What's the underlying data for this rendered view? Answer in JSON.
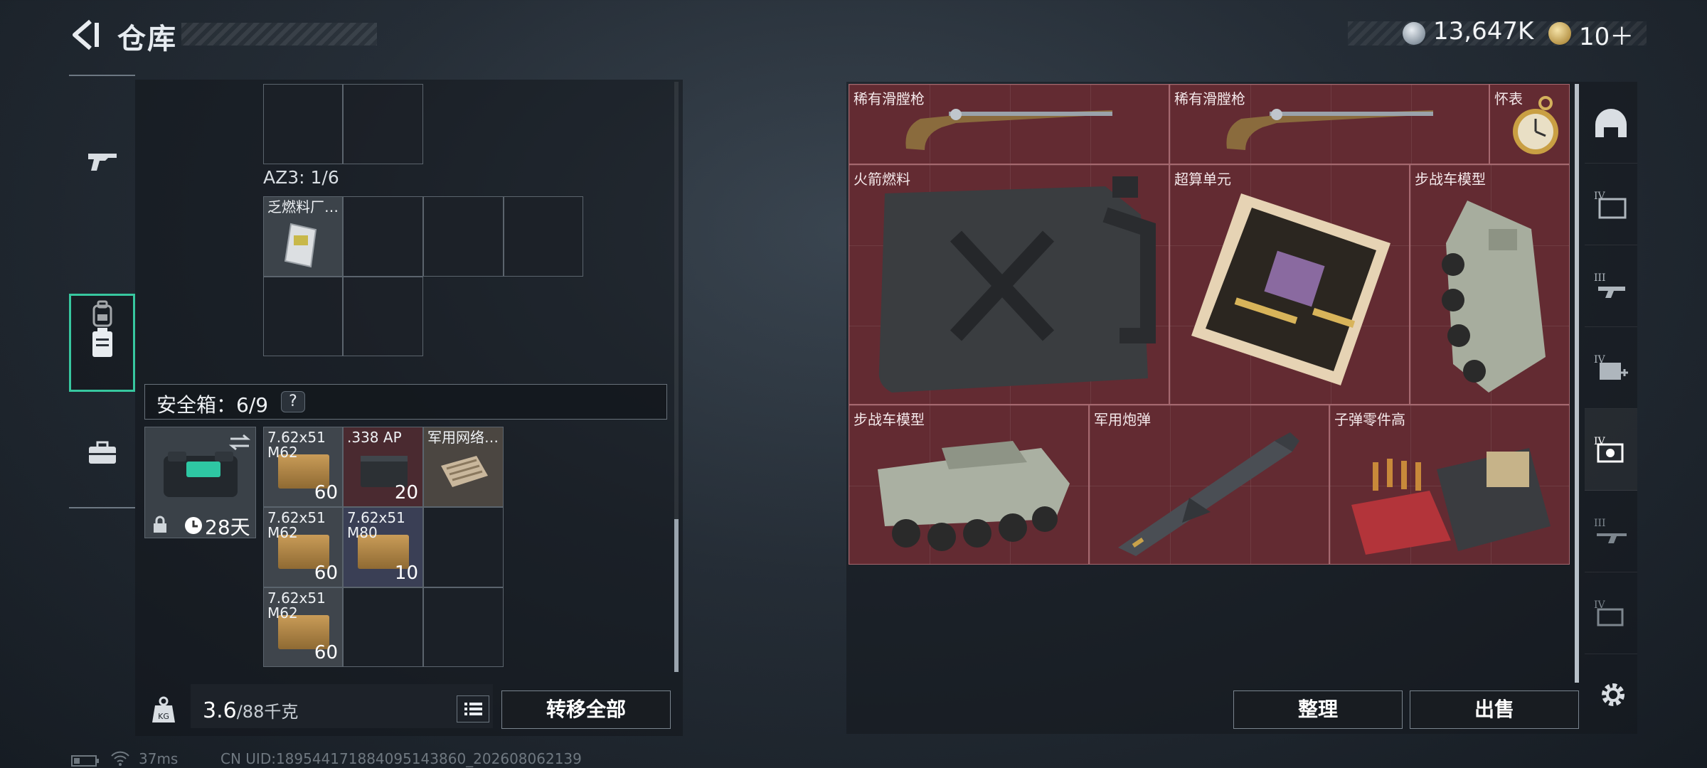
{
  "header": {
    "title": "仓库",
    "currencies": [
      {
        "icon": "silver-coin-icon",
        "value": "13,647K"
      },
      {
        "icon": "gold-coin-icon",
        "value": "10＋"
      }
    ]
  },
  "left_nav": {
    "items": [
      {
        "name": "weapons",
        "icon": "rifle-icon"
      },
      {
        "name": "armor",
        "icon": "backpack-icon"
      },
      {
        "name": "containers",
        "icon": "container-icon",
        "active": true
      },
      {
        "name": "case",
        "icon": "briefcase-icon"
      }
    ]
  },
  "inventory": {
    "az3_label": "AZ3: 1/6",
    "fuel_item_name": "乏燃料厂…",
    "safe_box": {
      "label": "安全箱：6/9",
      "help": "?"
    },
    "secure_case": {
      "time": "28天"
    },
    "ammo": [
      {
        "name": "7.62x51 M62",
        "count": "60"
      },
      {
        "name": ".338 AP",
        "count": "20"
      },
      {
        "name": "军用网络…",
        "count": ""
      },
      {
        "name": "7.62x51 M62",
        "count": "60"
      },
      {
        "name": "7.62x51 M80",
        "count": "10"
      },
      {
        "name": "7.62x51 M62",
        "count": "60"
      }
    ]
  },
  "footer_left": {
    "kg_label": "KG",
    "weight_current": "3.6",
    "weight_max": "/88千克",
    "transfer_all": "转移全部"
  },
  "stash": {
    "items": [
      {
        "name": "稀有滑膛枪",
        "icon": "musket-icon"
      },
      {
        "name": "稀有滑膛枪",
        "icon": "musket-icon"
      },
      {
        "name": "怀表",
        "icon": "pocket-watch-icon"
      },
      {
        "name": "火箭燃料",
        "icon": "jerrycan-icon"
      },
      {
        "name": "超算单元",
        "icon": "circuit-board-icon"
      },
      {
        "name": "步战车模型",
        "icon": "ifv-model-icon"
      },
      {
        "name": "步战车模型",
        "icon": "ifv-model-icon"
      },
      {
        "name": "军用炮弹",
        "icon": "missile-icon"
      },
      {
        "name": "子弹零件高",
        "icon": "bullet-parts-icon"
      }
    ],
    "sort_label": "整理",
    "sell_label": "出售"
  },
  "right_nav": {
    "items": [
      {
        "name": "helmet",
        "icon": "helmet-icon"
      },
      {
        "name": "tier-4-folder",
        "icon": "folder-iv-icon"
      },
      {
        "name": "tier-3-gun",
        "icon": "gun-iii-icon"
      },
      {
        "name": "tier-4-medical",
        "icon": "medical-iv-icon"
      },
      {
        "name": "tier-4-gear",
        "icon": "gear-iv-icon",
        "active": true
      },
      {
        "name": "tier-3-rifle",
        "icon": "rifle-iii-icon"
      },
      {
        "name": "tier-4-tool",
        "icon": "tool-iv-icon"
      }
    ],
    "settings_icon": "gear-icon"
  },
  "status": {
    "ping": "37ms",
    "uid": "CN UID:18954417188409514386​0_202608062139"
  },
  "colors": {
    "accent": "#37c79f",
    "stash_bg": "#632b32"
  }
}
